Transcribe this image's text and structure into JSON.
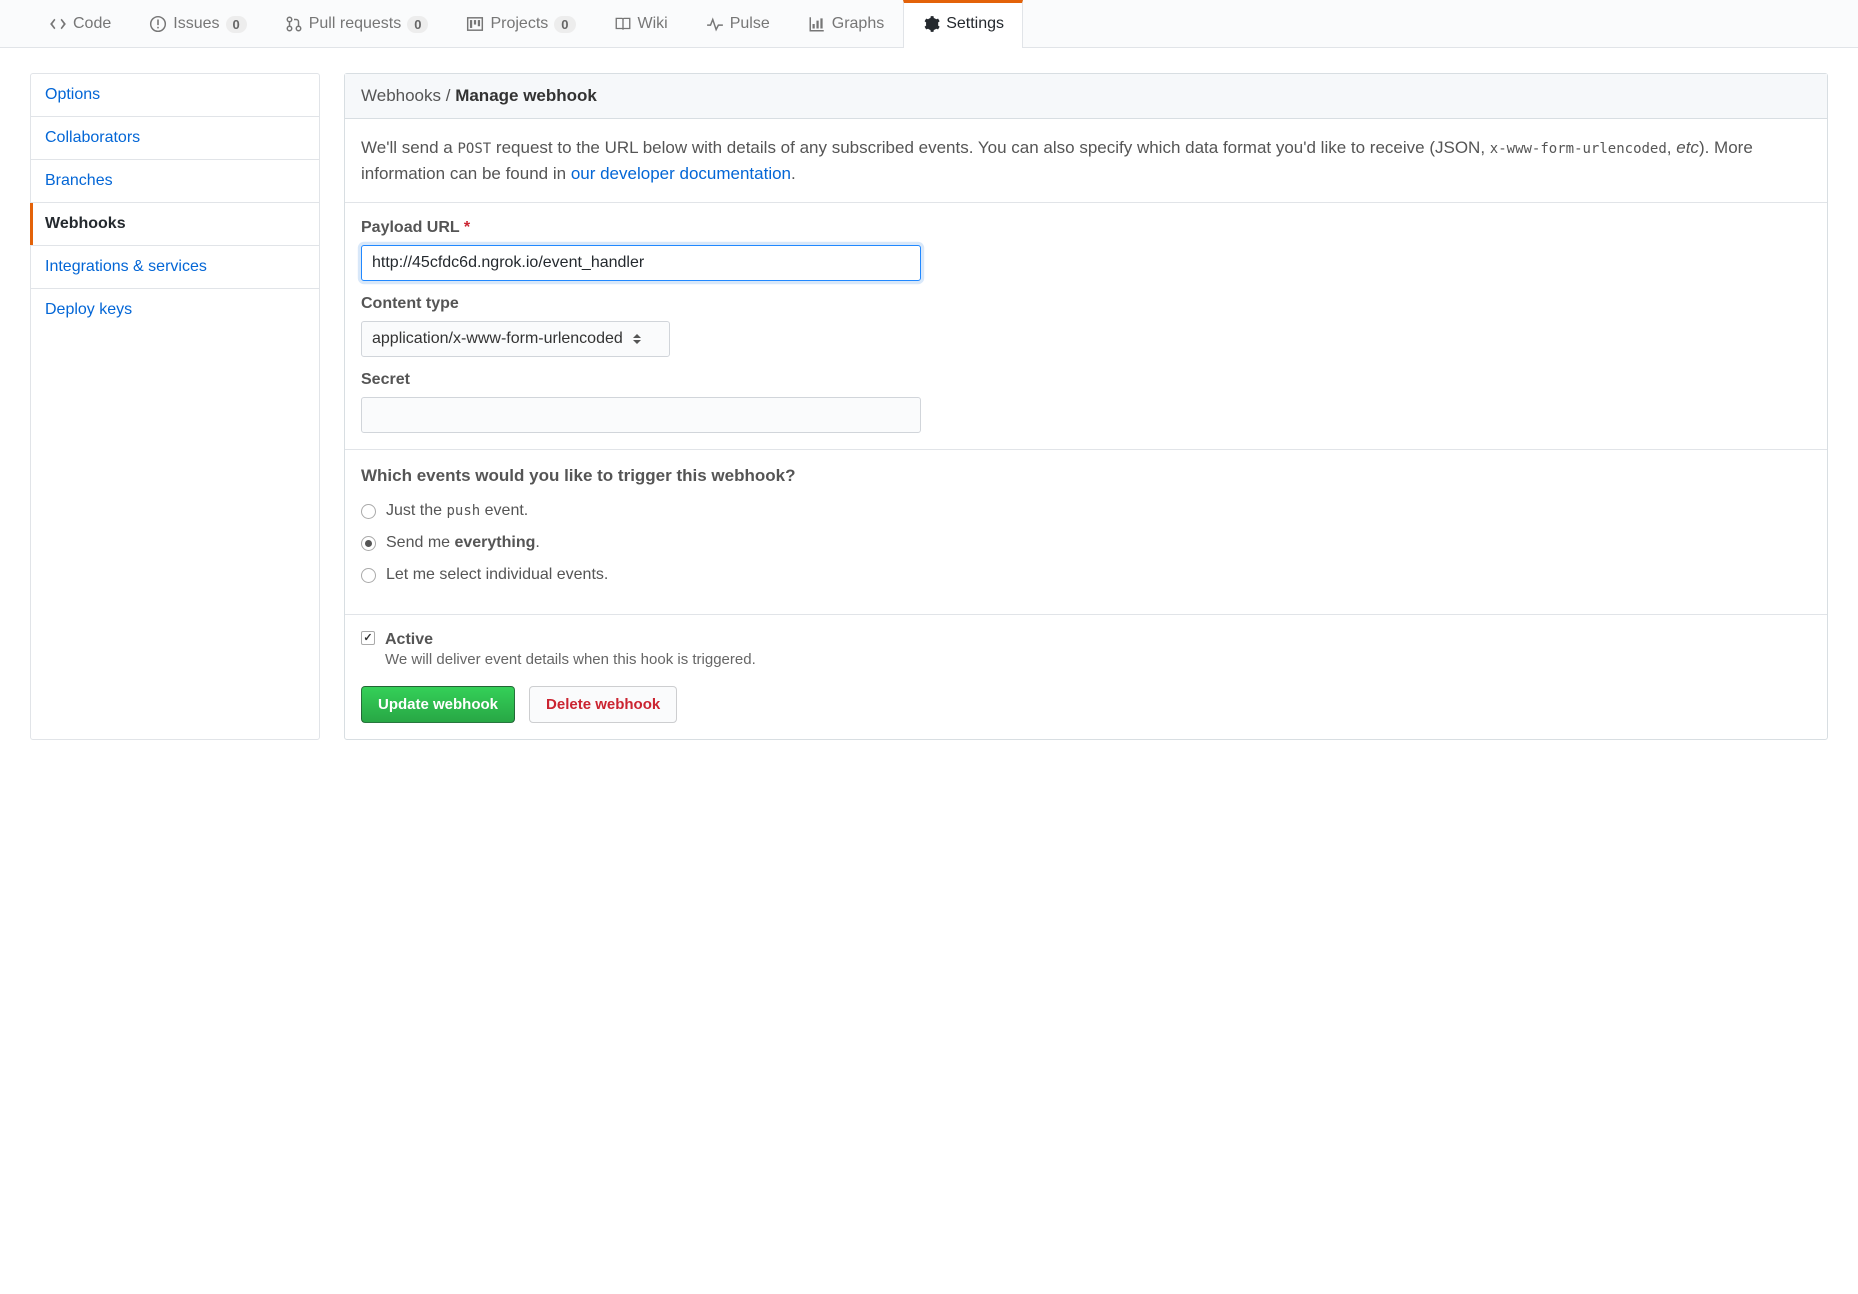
{
  "tabs": {
    "code": "Code",
    "issues": "Issues",
    "issues_count": "0",
    "pull_requests": "Pull requests",
    "pull_requests_count": "0",
    "projects": "Projects",
    "projects_count": "0",
    "wiki": "Wiki",
    "pulse": "Pulse",
    "graphs": "Graphs",
    "settings": "Settings"
  },
  "sidenav": {
    "options": "Options",
    "collaborators": "Collaborators",
    "branches": "Branches",
    "webhooks": "Webhooks",
    "integrations": "Integrations & services",
    "deploy_keys": "Deploy keys"
  },
  "header": {
    "breadcrumb_root": "Webhooks",
    "breadcrumb_sep": " / ",
    "breadcrumb_current": "Manage webhook"
  },
  "intro": {
    "part1": "We'll send a ",
    "code1": "POST",
    "part2": " request to the URL below with details of any subscribed events. You can also specify which data format you'd like to receive (JSON, ",
    "code2": "x-www-form-urlencoded",
    "part3": ", ",
    "em": "etc",
    "part4": "). More information can be found in ",
    "link": "our developer documentation",
    "part5": "."
  },
  "form": {
    "payload_url_label": "Payload URL",
    "payload_url_value": "http://45cfdc6d.ngrok.io/event_handler",
    "content_type_label": "Content type",
    "content_type_value": "application/x-www-form-urlencoded",
    "secret_label": "Secret",
    "secret_value": ""
  },
  "events": {
    "heading": "Which events would you like to trigger this webhook?",
    "opt1_a": "Just the ",
    "opt1_code": "push",
    "opt1_b": " event.",
    "opt2_a": "Send me ",
    "opt2_b": "everything",
    "opt2_c": ".",
    "opt3": "Let me select individual events."
  },
  "active": {
    "label": "Active",
    "note": "We will deliver event details when this hook is triggered."
  },
  "buttons": {
    "update": "Update webhook",
    "delete": "Delete webhook"
  }
}
